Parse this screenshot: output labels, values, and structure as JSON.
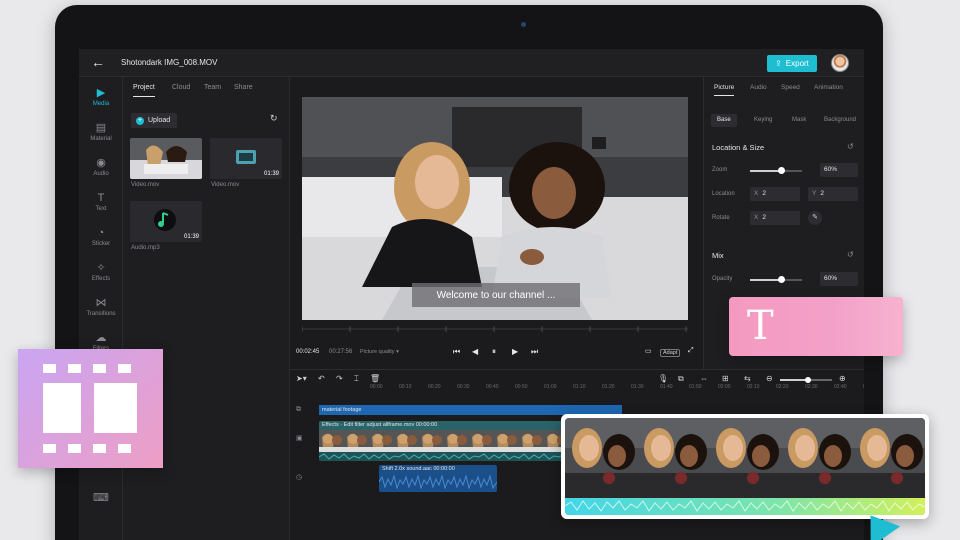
{
  "app": {
    "filename": "Shotondark IMG_008.MOV",
    "export_label": "Export"
  },
  "rail": [
    {
      "label": "Media",
      "icon": "media-icon",
      "glyph": "▶"
    },
    {
      "label": "Material",
      "icon": "material-icon",
      "glyph": "▤"
    },
    {
      "label": "Audio",
      "icon": "audio-icon",
      "glyph": "◉"
    },
    {
      "label": "Text",
      "icon": "text-icon",
      "glyph": "T"
    },
    {
      "label": "Sticker",
      "icon": "sticker-icon",
      "glyph": "◔"
    },
    {
      "label": "Effects",
      "icon": "effects-icon",
      "glyph": "✧"
    },
    {
      "label": "Transitions",
      "icon": "transitions-icon",
      "glyph": "⋈"
    },
    {
      "label": "Filters",
      "icon": "filters-icon",
      "glyph": "☁"
    }
  ],
  "project": {
    "tabs": [
      "Project",
      "Cloud",
      "Team",
      "Share"
    ],
    "upload_label": "Upload",
    "media": [
      {
        "name": "Video.mov",
        "duration": ""
      },
      {
        "name": "Video.mov",
        "duration": "01:39"
      },
      {
        "name": "Audio.mp3",
        "duration": "01:39"
      }
    ]
  },
  "preview": {
    "caption": "Welcome to our channel ...",
    "current_time": "00:02:45",
    "total_time": "00:27:56",
    "quality": "Picture quality",
    "adapt": "Adapt"
  },
  "props": {
    "tabs": [
      "Picture",
      "Audio",
      "Speed",
      "Animation"
    ],
    "subtabs": [
      "Base",
      "Keying",
      "Mask",
      "Background"
    ],
    "location_size_title": "Location & Size",
    "zoom_label": "Zoom",
    "zoom_value": "60%",
    "zoom_level": 0.6,
    "location_label": "Location",
    "location_x": "2",
    "location_y": "2",
    "rotate_label": "Rotate",
    "rotate_x": "2",
    "mix_title": "Mix",
    "opacity_label": "Opacity",
    "opacity_value": "60%",
    "opacity_level": 0.6,
    "axis_x": "X",
    "axis_y": "Y"
  },
  "timeline": {
    "ticks": [
      "00:00",
      "00:10",
      "00:20",
      "00:30",
      "00:40",
      "00:50",
      "01:00",
      "01:10",
      "01:20",
      "01:30",
      "01:40",
      "01:50",
      "02:00",
      "02:10",
      "02:20",
      "02:30",
      "02:40",
      "02:50"
    ],
    "overlay_clip": "material footage",
    "main_clip": "Effects · Edit   filter   adjust   allframe.mov   00:00:00",
    "audio_clip": "Shift 2.0x   sound.aac   00:00:00"
  },
  "colors": {
    "accent": "#1fbdd1",
    "film_card": "#d9a3df",
    "text_card": "#f49ac0"
  }
}
